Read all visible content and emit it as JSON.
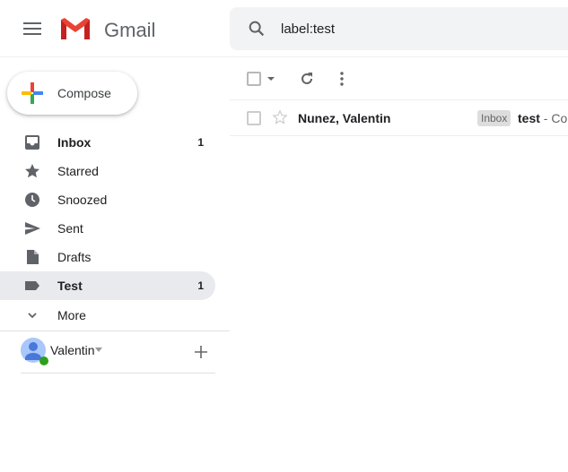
{
  "header": {
    "app_name": "Gmail",
    "search_query": "label:test"
  },
  "compose": {
    "label": "Compose"
  },
  "sidebar": {
    "items": [
      {
        "label": "Inbox",
        "count": "1",
        "icon": "inbox-icon"
      },
      {
        "label": "Starred",
        "count": "",
        "icon": "star-icon"
      },
      {
        "label": "Snoozed",
        "count": "",
        "icon": "clock-icon"
      },
      {
        "label": "Sent",
        "count": "",
        "icon": "send-icon"
      },
      {
        "label": "Drafts",
        "count": "",
        "icon": "draft-icon"
      },
      {
        "label": "Test",
        "count": "1",
        "icon": "label-icon"
      },
      {
        "label": "More",
        "count": "",
        "icon": "chevron-down-icon"
      }
    ]
  },
  "hangouts": {
    "user": "Valentin"
  },
  "emails": [
    {
      "sender": "Nunez, Valentin",
      "label": "Inbox",
      "subject": "test",
      "snippet": " - Co"
    }
  ]
}
